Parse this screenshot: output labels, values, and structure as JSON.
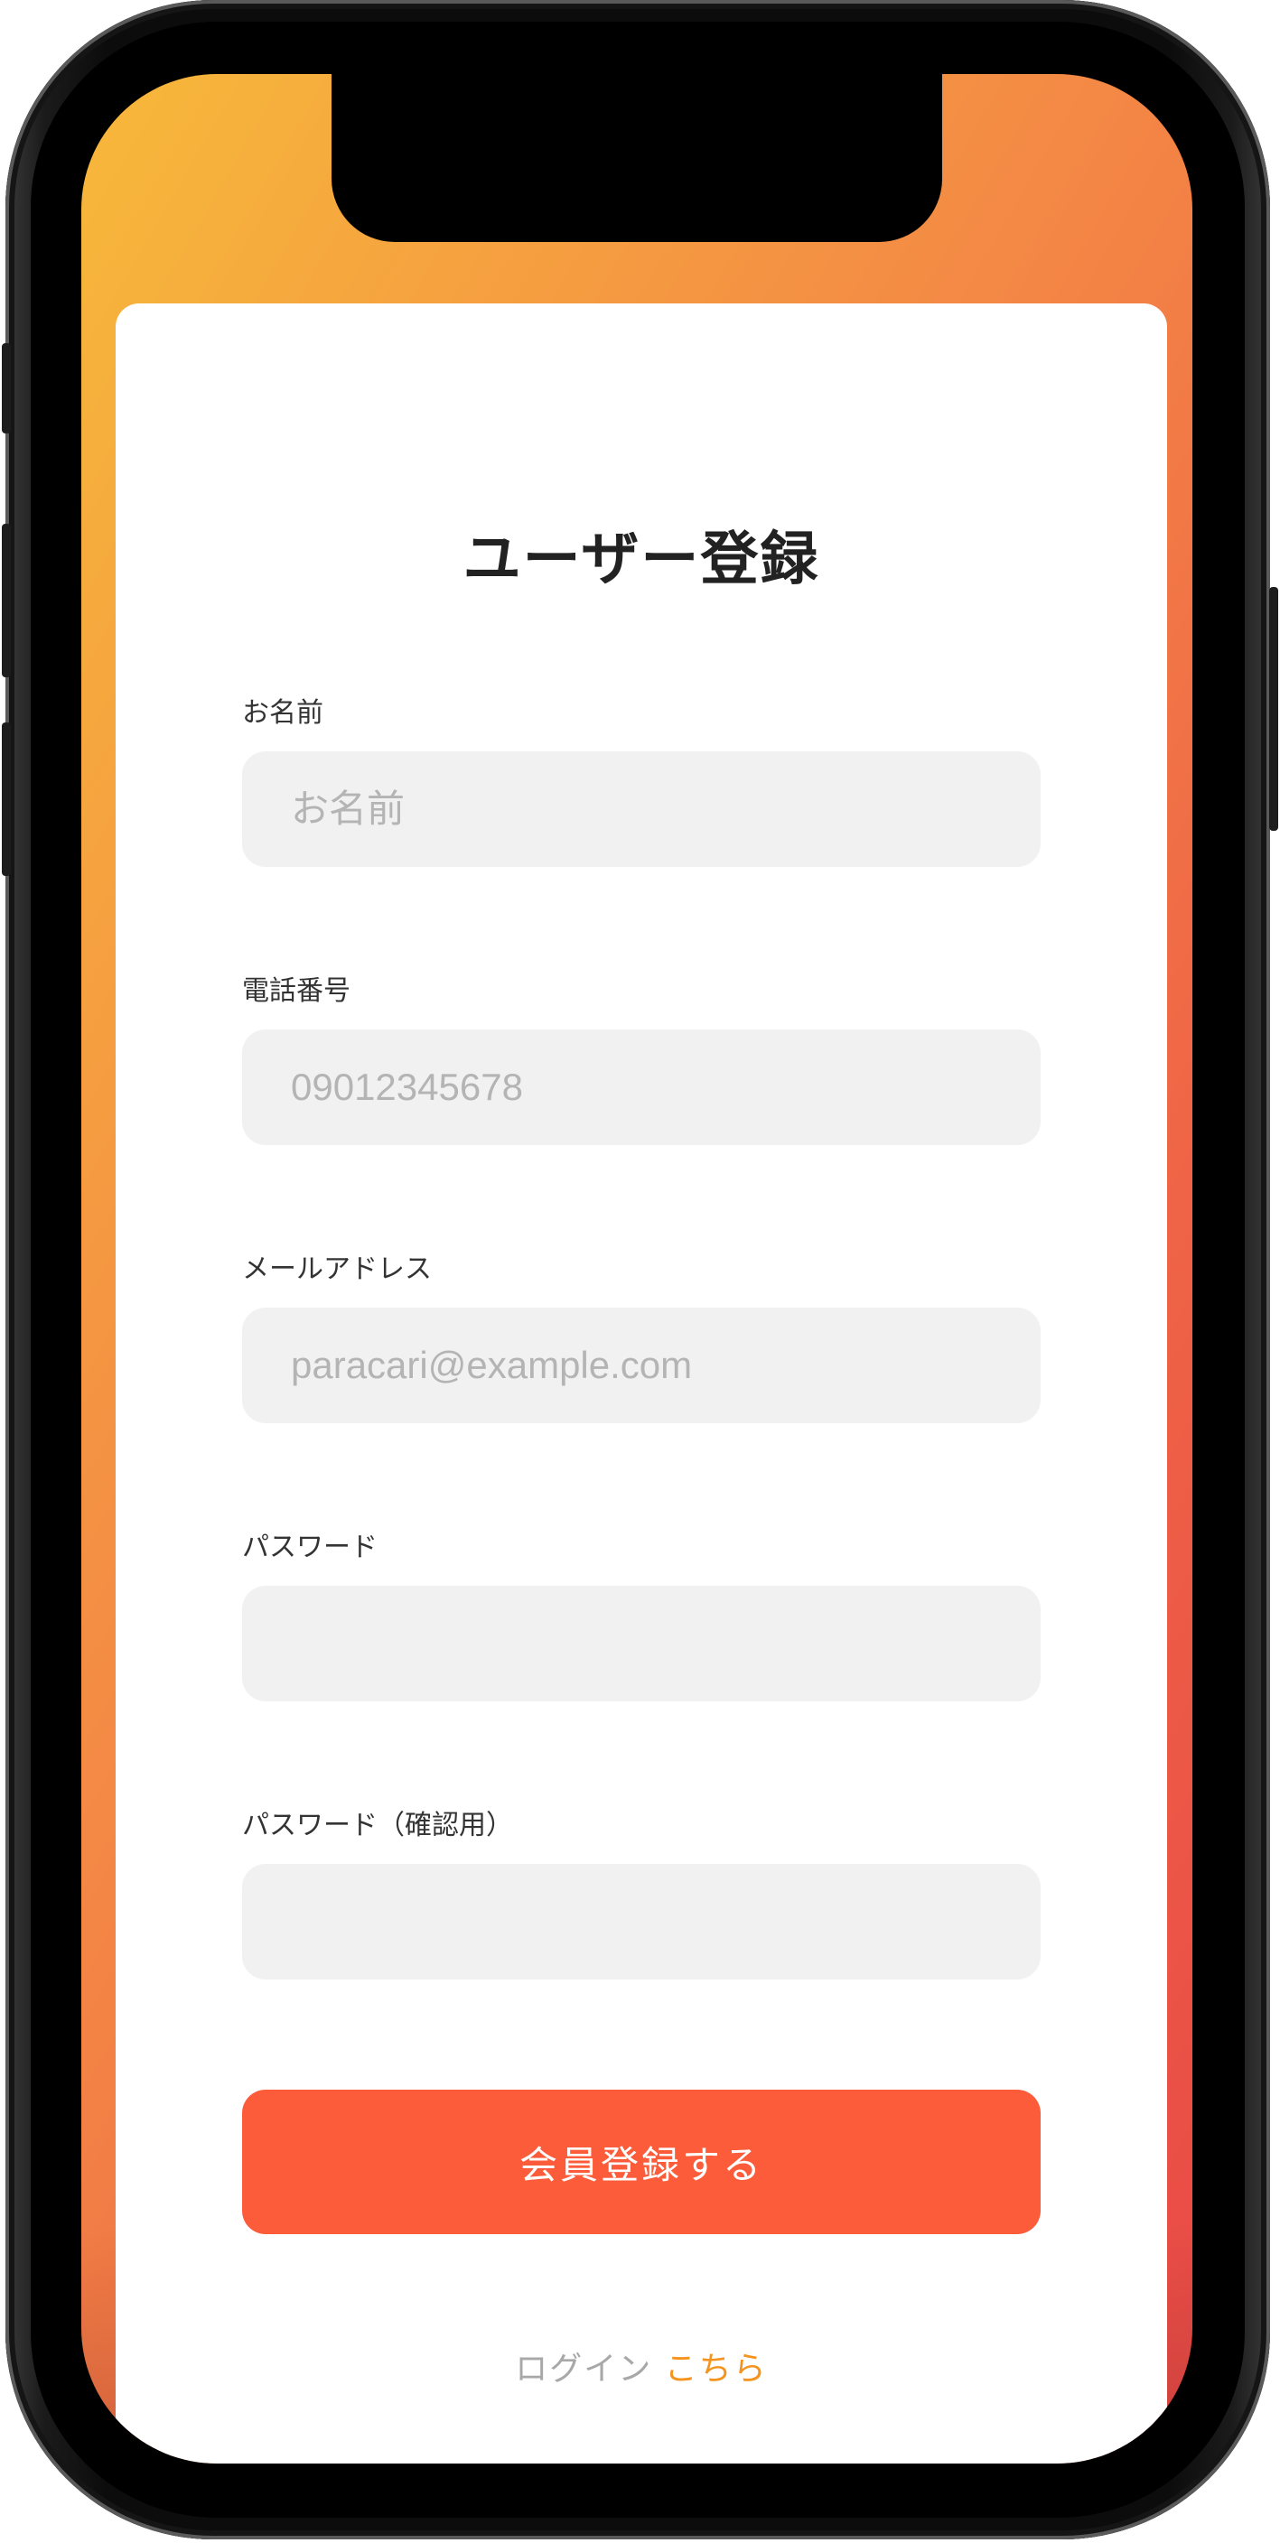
{
  "colors": {
    "gradient_start": "#f7b93a",
    "gradient_end": "#e84846",
    "accent": "#fd5c3b",
    "link": "#f5931f",
    "input_background": "#f1f1f1"
  },
  "form": {
    "title": "ユーザー登録",
    "fields": [
      {
        "label": "お名前",
        "placeholder": "お名前",
        "value": ""
      },
      {
        "label": "電話番号",
        "placeholder": "09012345678",
        "value": ""
      },
      {
        "label": "メールアドレス",
        "placeholder": "paracari@example.com",
        "value": ""
      },
      {
        "label": "パスワード",
        "placeholder": "",
        "value": ""
      },
      {
        "label": "パスワード（確認用）",
        "placeholder": "",
        "value": ""
      }
    ],
    "submit_label": "会員登録する"
  },
  "footer": {
    "login_prefix": "ログイン",
    "login_link": "こちら"
  }
}
